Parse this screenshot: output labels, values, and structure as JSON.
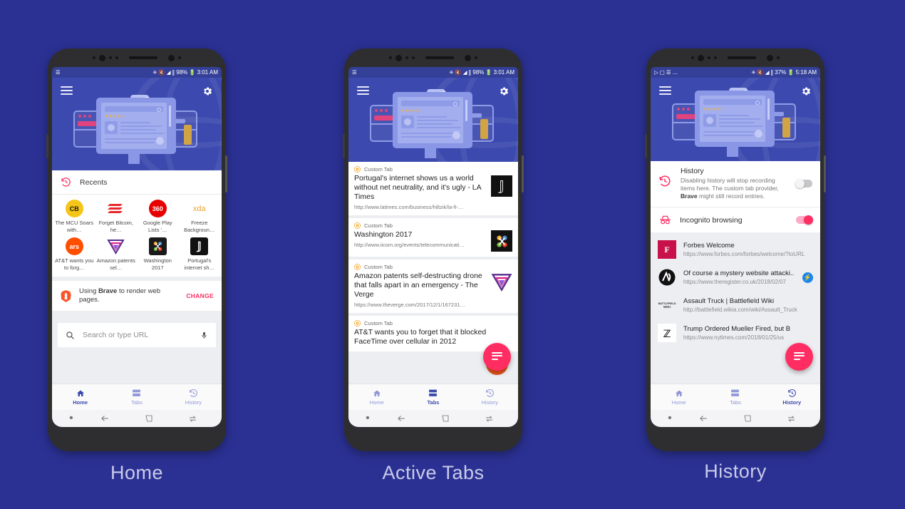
{
  "page": {
    "background_color": "#2b3193",
    "caption_color": "#c9cbe8"
  },
  "captions": {
    "phone1": "Home",
    "phone2": "Active Tabs",
    "phone3": "History"
  },
  "colors": {
    "accent_pink": "#ff2d62",
    "brand_blue": "#3b49ae",
    "hero_blue": "#3c49ae",
    "brave_orange": "#fb542b",
    "amp_blue": "#1b87e8"
  },
  "statusbars": {
    "phone1": {
      "battery": "98%",
      "time": "3:01 AM",
      "icons": [
        "list-icon",
        "bluetooth-icon",
        "mute-icon",
        "wifi-icon",
        "signal-icon",
        "battery-icon"
      ]
    },
    "phone2": {
      "battery": "98%",
      "time": "3:01 AM",
      "icons": [
        "list-icon",
        "bluetooth-icon",
        "mute-icon",
        "wifi-icon",
        "signal-icon",
        "battery-icon"
      ]
    },
    "phone3": {
      "battery": "37%",
      "time": "5:18 AM",
      "icons": [
        "play-icon",
        "video-icon",
        "list-icon",
        "ellipsis",
        "bluetooth-icon",
        "mute-icon",
        "wifi-icon",
        "signal-icon",
        "battery-icon"
      ]
    }
  },
  "appbar": {
    "menu_icon": "hamburger-menu-icon",
    "settings_icon": "gear-icon"
  },
  "home": {
    "recents": {
      "icon": "history-icon",
      "title": "Recents",
      "items": [
        {
          "label": "The MCU Soars with…",
          "icon_text": "CB",
          "icon_kind": "cb"
        },
        {
          "label": "Forget Bitcoin, he…",
          "icon_text": "",
          "icon_kind": "sheets"
        },
        {
          "label": "Google Play Lists '…",
          "icon_text": "360",
          "icon_kind": "360"
        },
        {
          "label": "Freeze Backgroun…",
          "icon_text": "xda",
          "icon_kind": "xda"
        },
        {
          "label": "AT&T wants you to forg…",
          "icon_text": "ars",
          "icon_kind": "ars"
        },
        {
          "label": "Amazon patents sel…",
          "icon_text": "",
          "icon_kind": "verge"
        },
        {
          "label": "Washington 2017",
          "icon_text": "",
          "icon_kind": "joomla"
        },
        {
          "label": "Portugal's internet sh…",
          "icon_text": "L",
          "icon_kind": "latimes"
        }
      ]
    },
    "brave_banner": {
      "icon": "brave-lion-icon",
      "text_before": "Using ",
      "brand": "Brave",
      "text_after": " to render web pages.",
      "action_label": "CHANGE"
    },
    "search": {
      "search_icon": "search-icon",
      "placeholder": "Search or type URL",
      "mic_icon": "microphone-icon"
    }
  },
  "tabs": {
    "provider_label": "Custom Tab",
    "provider_icon": "brave-circle-icon",
    "items": [
      {
        "title": "Portugal's internet shows us a world without net neutrality, and it's ugly - LA Times",
        "url": "http://www.latimes.com/business/hiltzik/la-fi-…",
        "icon_kind": "latimes"
      },
      {
        "title": "Washington 2017",
        "url": "http://www.iicom.org/events/telecommunicati…",
        "icon_kind": "joomla"
      },
      {
        "title": "Amazon patents self-destructing drone that falls apart in an emergency - The Verge",
        "url": "https://www.theverge.com/2017/12/1/167231…",
        "icon_kind": "verge"
      },
      {
        "title": "AT&T wants you to forget that it blocked FaceTime over cellular in 2012",
        "url": "",
        "icon_kind": "none"
      }
    ]
  },
  "history": {
    "header": {
      "icon": "history-icon",
      "title": "History",
      "description_before": "Disabling history will stop recording items here. The custom tab provider, ",
      "brand": "Brave",
      "description_after": " might still record entries.",
      "toggle_state": "off"
    },
    "incognito": {
      "icon": "incognito-icon",
      "label": "Incognito browsing",
      "toggle_state": "on"
    },
    "items": [
      {
        "title": "Forbes Welcome",
        "url": "https://www.forbes.com/forbes/welcome/?toURL",
        "icon_kind": "forbes",
        "icon_text": "F",
        "badge": ""
      },
      {
        "title": "Of course a mystery website attacki..",
        "url": "https://www.theregister.co.uk/2018/02/07",
        "icon_kind": "register",
        "icon_text": "",
        "badge": "amp"
      },
      {
        "title": "Assault Truck | Battlefield Wiki",
        "url": "http://battlefield.wikia.com/wiki/Assault_Truck",
        "icon_kind": "battlefield",
        "icon_text": "BATTLEFIELD WIKI",
        "badge": ""
      },
      {
        "title": "Trump Ordered Mueller Fired, but B",
        "url": "https://www.nytimes.com/2018/01/25/us",
        "icon_kind": "nytimes",
        "icon_text": "T",
        "badge": ""
      }
    ]
  },
  "fab": {
    "icon": "reader-lines-icon"
  },
  "bottom_nav": {
    "items": [
      {
        "label": "Home",
        "icon": "home-icon"
      },
      {
        "label": "Tabs",
        "icon": "tabs-icon"
      },
      {
        "label": "History",
        "icon": "history-icon"
      }
    ],
    "active": {
      "phone1": "Home",
      "phone2": "Tabs",
      "phone3": "History"
    }
  },
  "system_nav": {
    "items": [
      "dot-indicator",
      "back-icon",
      "home-square-icon",
      "recents-icon"
    ]
  }
}
